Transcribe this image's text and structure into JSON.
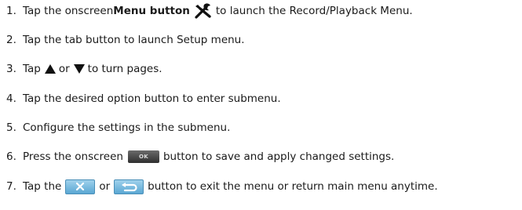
{
  "steps": [
    {
      "num": "1.",
      "pre": "Tap the onscreen ",
      "bold": "Menu button",
      "post": " to launch the Record/Playback Menu.",
      "icon": "wrench-screwdriver-icon"
    },
    {
      "num": "2.",
      "text": "Tap the tab button to launch Setup menu."
    },
    {
      "num": "3.",
      "pre": "Tap ",
      "mid": " or ",
      "post": " to turn pages.",
      "icons": [
        "triangle-up-icon",
        "triangle-down-icon"
      ]
    },
    {
      "num": "4.",
      "text": "Tap the desired option button to enter submenu."
    },
    {
      "num": "5.",
      "text": "Configure the settings in the submenu."
    },
    {
      "num": "6.",
      "pre": "Press the onscreen ",
      "button_label": "OK",
      "post": " button to save and apply changed settings."
    },
    {
      "num": "7.",
      "pre": "Tap the ",
      "mid": " or ",
      "post": " button to exit the menu or return main menu anytime.",
      "icons": [
        "close-x-button-icon",
        "return-arrow-button-icon"
      ]
    }
  ]
}
